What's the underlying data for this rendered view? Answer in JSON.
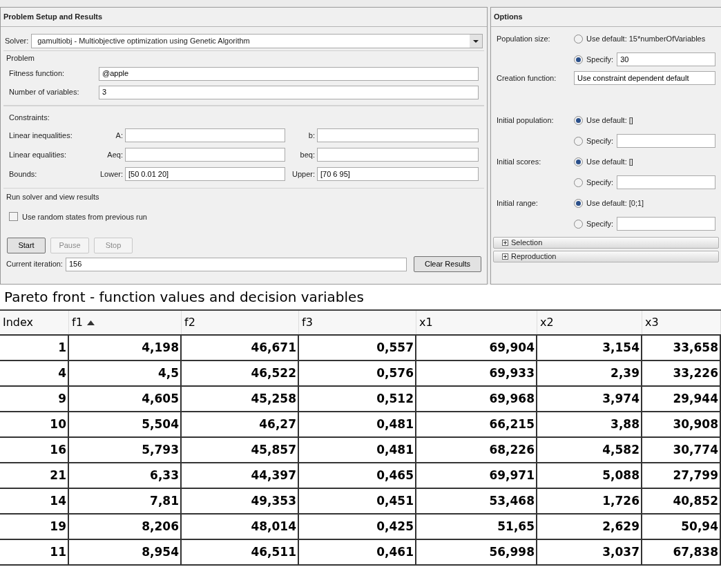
{
  "problem_panel": {
    "title": "Problem Setup and Results",
    "solver": {
      "label": "Solver:",
      "value": "gamultiobj - Multiobjective optimization using Genetic Algorithm"
    },
    "problem": {
      "title": "Problem",
      "fields": [
        {
          "label": "Fitness function:",
          "value": "@apple"
        },
        {
          "label": "Number of variables:",
          "value": "3"
        }
      ]
    },
    "constraints": {
      "title": "Constraints:",
      "rows": [
        {
          "label": "Linear inequalities:",
          "left_label": "A:",
          "right_label": "b:"
        },
        {
          "label": "Linear equalities:",
          "left_label": "Aeq:",
          "right_label": "beq:"
        },
        {
          "label": "Bounds:",
          "left_label": "Lower:",
          "left_value": "[50 0.01 20]",
          "right_label": "Upper:",
          "right_value": "[70 6 95]"
        }
      ]
    },
    "run": {
      "title": "Run solver and view results",
      "checkbox": {
        "label": "Use random states from previous run",
        "checked": false
      },
      "buttons": [
        {
          "label": "Start",
          "disabled": false
        },
        {
          "label": "Pause",
          "disabled": true
        },
        {
          "label": "Stop",
          "disabled": true
        }
      ],
      "iteration": {
        "label": "Current iteration:",
        "value": "156"
      },
      "clear_button": "Clear Results"
    }
  },
  "options_panel": {
    "title": "Options",
    "groups": [
      {
        "label": "Population size:",
        "options": [
          {
            "kind": "text",
            "label": "Use default: 15*numberOfVariables",
            "selected": false
          },
          {
            "kind": "input",
            "label": "Specify:",
            "value": "30",
            "selected": true
          }
        ]
      },
      {
        "label": "Creation function:",
        "kind": "select",
        "value": "Use constraint dependent default"
      },
      {
        "label": "Initial population:",
        "options": [
          {
            "kind": "text",
            "label": "Use default: []",
            "selected": true
          },
          {
            "kind": "input",
            "label": "Specify:",
            "selected": false
          }
        ]
      },
      {
        "label": "Initial scores:",
        "options": [
          {
            "kind": "text",
            "label": "Use default: []",
            "selected": true
          },
          {
            "kind": "input",
            "label": "Specify:",
            "selected": false
          }
        ]
      },
      {
        "label": "Initial range:",
        "options": [
          {
            "kind": "text",
            "label": "Use default: [0;1]",
            "selected": true
          },
          {
            "kind": "input",
            "label": "Specify:",
            "selected": false
          }
        ]
      }
    ],
    "sections": [
      {
        "label": "Selection",
        "expanded": false
      },
      {
        "label": "Reproduction",
        "expanded": false
      }
    ]
  },
  "results": {
    "title": "Pareto front - function values and decision variables",
    "columns": [
      {
        "label": "Index",
        "sorted": false
      },
      {
        "label": "f1",
        "sorted": true
      },
      {
        "label": "f2",
        "sorted": false
      },
      {
        "label": "f3",
        "sorted": false
      },
      {
        "label": "x1",
        "sorted": false
      },
      {
        "label": "x2",
        "sorted": false
      },
      {
        "label": "x3",
        "sorted": false
      }
    ],
    "rows": [
      [
        "1",
        "4,198",
        "46,671",
        "0,557",
        "69,904",
        "3,154",
        "33,658"
      ],
      [
        "4",
        "4,5",
        "46,522",
        "0,576",
        "69,933",
        "2,39",
        "33,226"
      ],
      [
        "9",
        "4,605",
        "45,258",
        "0,512",
        "69,968",
        "3,974",
        "29,944"
      ],
      [
        "10",
        "5,504",
        "46,27",
        "0,481",
        "66,215",
        "3,88",
        "30,908"
      ],
      [
        "16",
        "5,793",
        "45,857",
        "0,481",
        "68,226",
        "4,582",
        "30,774"
      ],
      [
        "21",
        "6,33",
        "44,397",
        "0,465",
        "69,971",
        "5,088",
        "27,799"
      ],
      [
        "14",
        "7,81",
        "49,353",
        "0,451",
        "53,468",
        "1,726",
        "40,852"
      ],
      [
        "19",
        "8,206",
        "48,014",
        "0,425",
        "51,65",
        "2,629",
        "50,94"
      ],
      [
        "11",
        "8,954",
        "46,511",
        "0,461",
        "56,998",
        "3,037",
        "67,838"
      ]
    ]
  }
}
